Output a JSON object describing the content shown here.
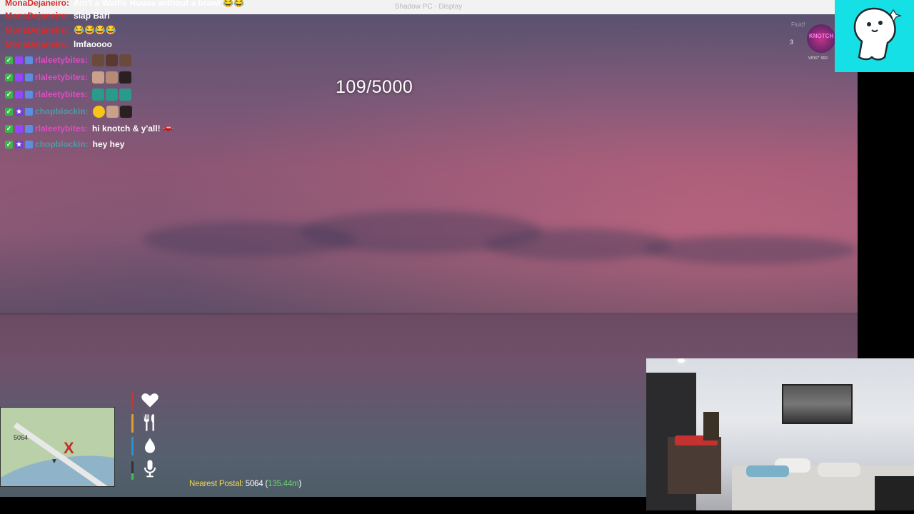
{
  "window": {
    "title": "Shadow PC - Display"
  },
  "hud": {
    "counter": "109/5000",
    "nearest_postal_label": "Nearest Postal:",
    "postal_value": "5064",
    "postal_paren_open": " (",
    "postal_distance": "135.44m",
    "postal_paren_close": ")",
    "minimap_postal": "5064",
    "minimap_marker": "X",
    "status_colors": {
      "health": "#c0393a",
      "hunger": "#e89a2a",
      "thirst": "#2f8fd6",
      "voice": "#3fbf5a"
    }
  },
  "chat": {
    "messages": [
      {
        "user": "MonaDejaneiro:",
        "color": "#d32f2f",
        "text": "Ain't a Waffle House without a brawl 😂😂",
        "badges": []
      },
      {
        "user": "MonaDejaneiro:",
        "color": "#d32f2f",
        "text": "slap Bari",
        "badges": []
      },
      {
        "user": "MonaDejaneiro:",
        "color": "#d32f2f",
        "text": "😂😂😂😂",
        "badges": []
      },
      {
        "user": "MonaDejaneiro:",
        "color": "#d32f2f",
        "text": "lmfaoooo",
        "badges": []
      },
      {
        "user": "rlaleetybites:",
        "color": "#d94fbf",
        "text": "",
        "badges": [
          "check",
          "prime",
          "gift"
        ],
        "emotes": 3
      },
      {
        "user": "rlaleetybites:",
        "color": "#d94fbf",
        "text": "",
        "badges": [
          "check",
          "prime",
          "gift"
        ],
        "emotes": 3
      },
      {
        "user": "rlaleetybites:",
        "color": "#d94fbf",
        "text": "",
        "badges": [
          "check",
          "prime",
          "gift"
        ],
        "emotes": 3
      },
      {
        "user": "chopblockin:",
        "color": "#4f9aa6",
        "text": "",
        "badges": [
          "check",
          "star",
          "gift"
        ],
        "emotes": 3
      },
      {
        "user": "rlaleetybites:",
        "color": "#d94fbf",
        "text": "hi knotch & y'all!",
        "badges": [
          "check",
          "prime",
          "gift"
        ]
      },
      {
        "user": "chopblockin:",
        "color": "#4f9aa6",
        "text": "hey hey",
        "badges": [
          "check",
          "star",
          "gift"
        ]
      }
    ]
  },
  "overlay": {
    "top_faded": "Fluid!",
    "viewer_count": "3",
    "brand_text": "KNOTCH",
    "sub_text": "vms* sto"
  }
}
